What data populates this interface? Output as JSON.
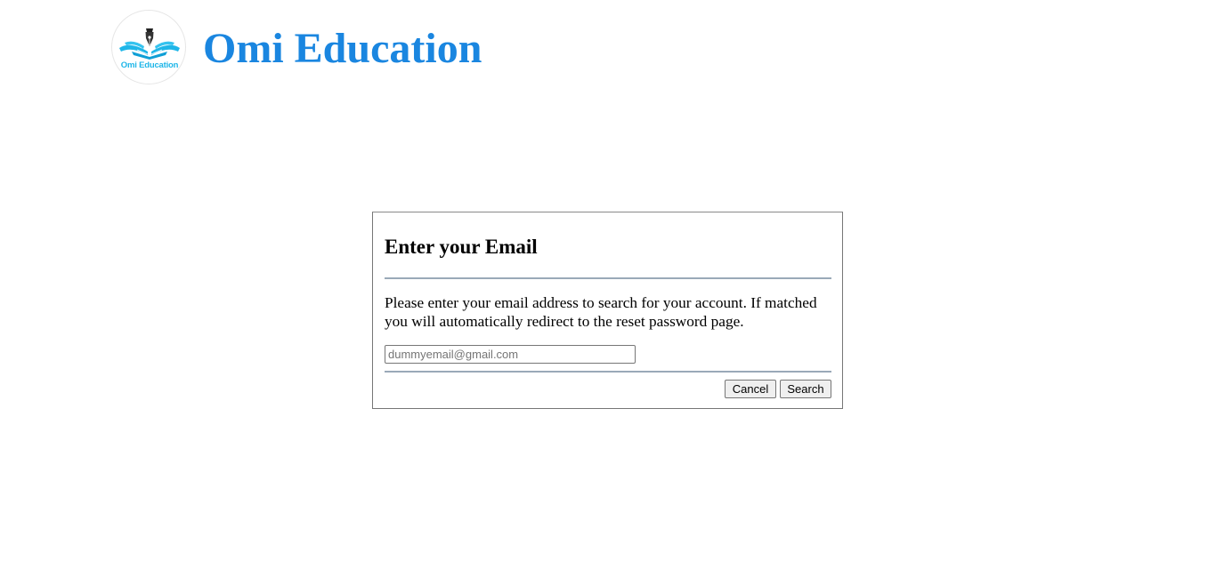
{
  "header": {
    "logo_text": "Omi Education",
    "site_title": "Omi Education"
  },
  "dialog": {
    "title": "Enter your Email",
    "message": "Please enter your email address to search for your account. If matched you will automatically redirect to the reset password page.",
    "email_placeholder": "dummyemail@gmail.com",
    "email_value": "",
    "cancel_label": "Cancel",
    "search_label": "Search"
  },
  "colors": {
    "brand_blue": "#1a86e0",
    "logo_cyan": "#1fb6e8",
    "divider": "#9aa9b8"
  },
  "icons": {
    "logo": "open-book-pen-nib-icon"
  }
}
